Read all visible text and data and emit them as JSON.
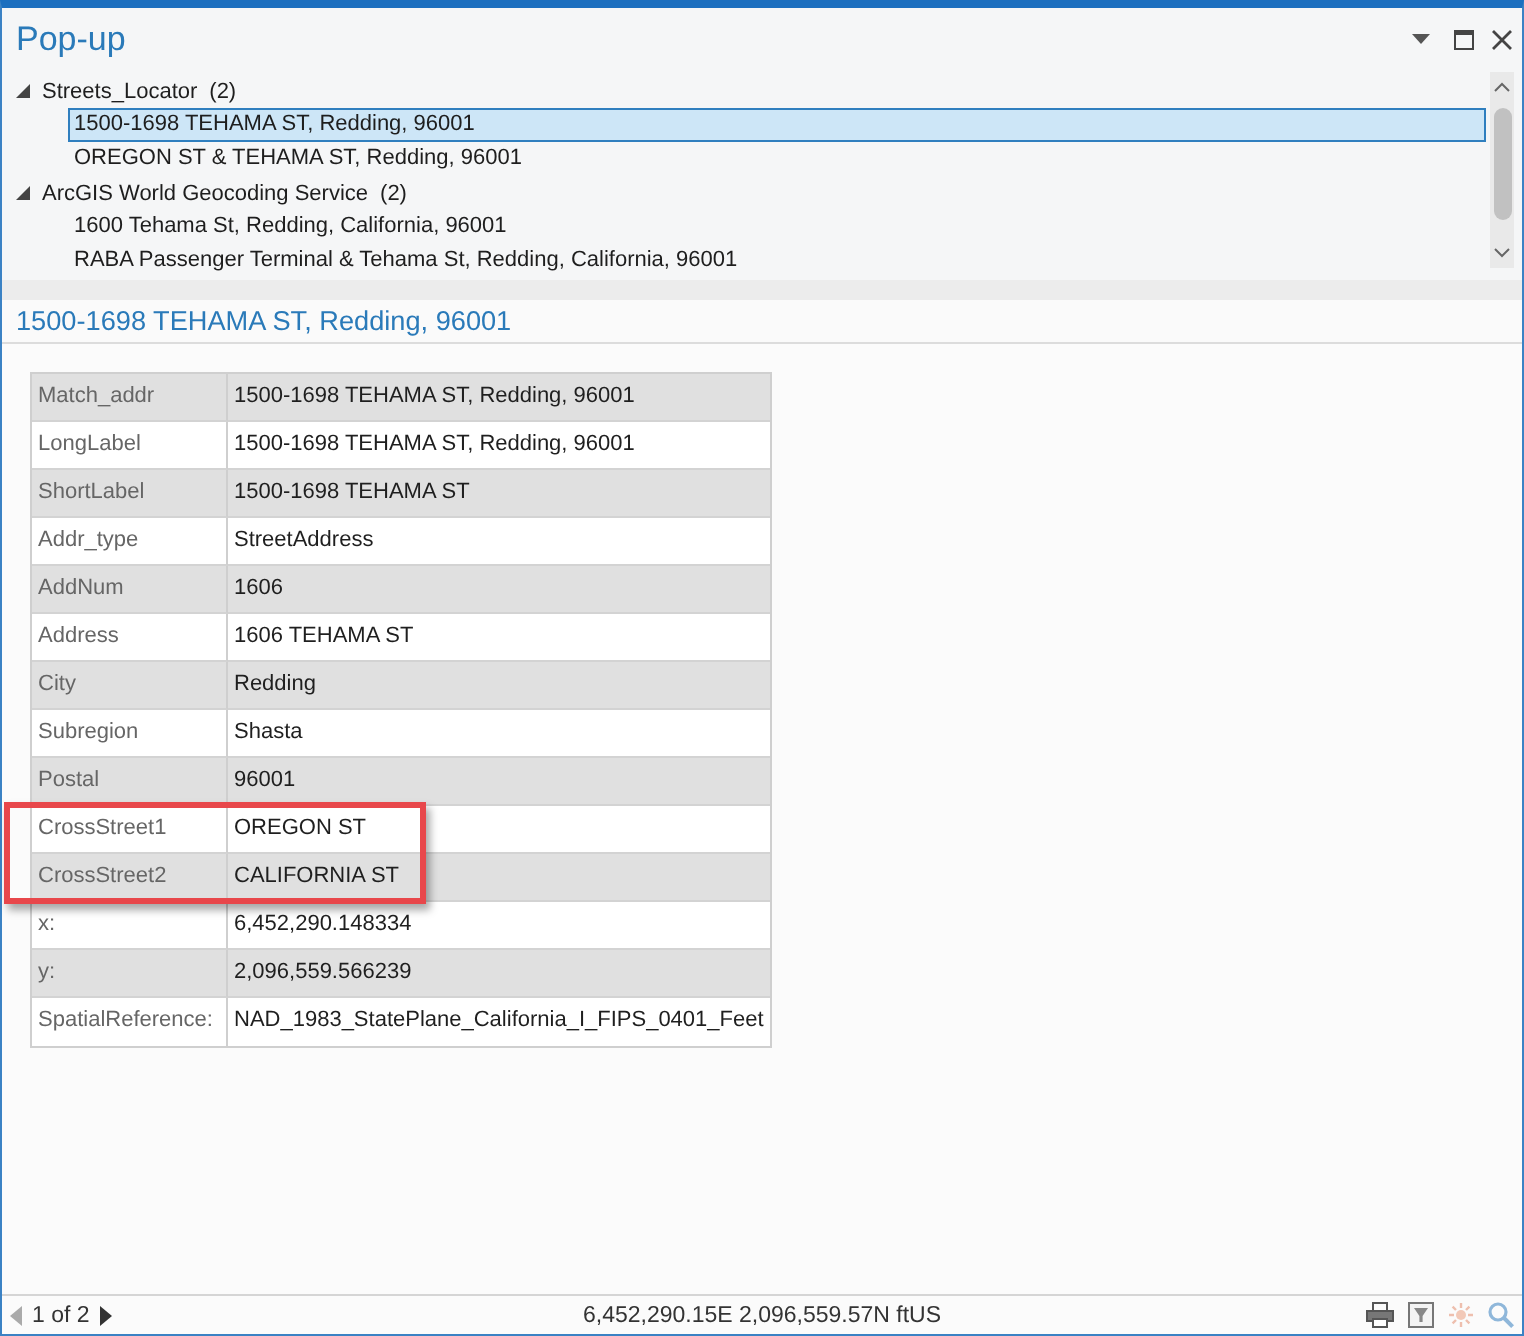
{
  "window": {
    "title": "Pop-up"
  },
  "results_tree": [
    {
      "label": "Streets_Locator",
      "count": "(2)",
      "expanded": true,
      "children": [
        {
          "label": "1500-1698 TEHAMA ST, Redding, 96001",
          "selected": true
        },
        {
          "label": "OREGON ST & TEHAMA ST, Redding, 96001",
          "selected": false
        }
      ]
    },
    {
      "label": "ArcGIS World Geocoding Service",
      "count": "(2)",
      "expanded": true,
      "children": [
        {
          "label": "1600 Tehama St, Redding, California, 96001",
          "selected": false
        },
        {
          "label": "RABA Passenger Terminal & Tehama St, Redding, California, 96001",
          "selected": false
        }
      ]
    }
  ],
  "detail": {
    "title": "1500-1698 TEHAMA ST, Redding, 96001",
    "fields": [
      {
        "name": "Match_addr",
        "value": "1500-1698 TEHAMA ST, Redding, 96001",
        "highlighted": false
      },
      {
        "name": "LongLabel",
        "value": "1500-1698 TEHAMA ST, Redding, 96001",
        "highlighted": false
      },
      {
        "name": "ShortLabel",
        "value": "1500-1698 TEHAMA ST",
        "highlighted": false
      },
      {
        "name": "Addr_type",
        "value": "StreetAddress",
        "highlighted": false
      },
      {
        "name": "AddNum",
        "value": "1606",
        "highlighted": false
      },
      {
        "name": "Address",
        "value": "1606 TEHAMA ST",
        "highlighted": false
      },
      {
        "name": "City",
        "value": "Redding",
        "highlighted": false
      },
      {
        "name": "Subregion",
        "value": "Shasta",
        "highlighted": false
      },
      {
        "name": "Postal",
        "value": "96001",
        "highlighted": false
      },
      {
        "name": "CrossStreet1",
        "value": "OREGON ST",
        "highlighted": true
      },
      {
        "name": "CrossStreet2",
        "value": "CALIFORNIA ST",
        "highlighted": true
      },
      {
        "name": "x:",
        "value": "6,452,290.148334",
        "highlighted": false
      },
      {
        "name": "y:",
        "value": "2,096,559.566239",
        "highlighted": false
      },
      {
        "name": "SpatialReference:",
        "value": "NAD_1983_StatePlane_California_I_FIPS_0401_Feet",
        "highlighted": false
      }
    ]
  },
  "status_bar": {
    "previous_enabled": false,
    "page": "1 of 2",
    "next_enabled": true,
    "coordinates": "6,452,290.15E 2,096,559.57N ftUS"
  }
}
